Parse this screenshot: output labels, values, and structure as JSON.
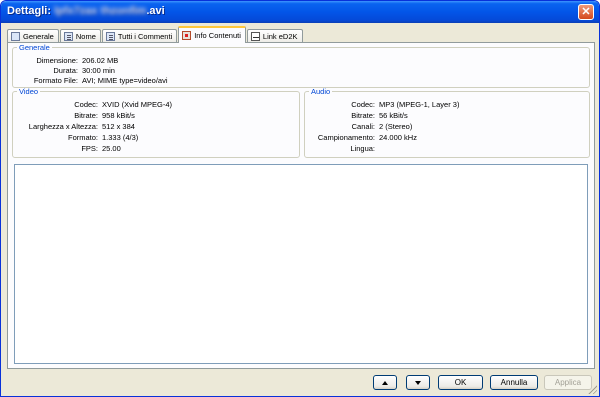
{
  "window": {
    "title_prefix": "Dettagli:",
    "title_obscured": "lpfx7zax  thzonfim",
    "title_suffix": ".avi",
    "close_symbol": "✕"
  },
  "tabs": [
    {
      "label": "Generale",
      "icon": "info-icon"
    },
    {
      "label": "Nome",
      "icon": "name-icon"
    },
    {
      "label": "Tutti i Commenti",
      "icon": "comments-icon"
    },
    {
      "label": "Info Contenuti",
      "icon": "content-info-icon",
      "active": true
    },
    {
      "label": "Link eD2K",
      "icon": "link-icon"
    }
  ],
  "generale": {
    "legend": "Generale",
    "rows": [
      {
        "key": "Dimensione:",
        "value": "206.02 MB"
      },
      {
        "key": "Durata:",
        "value": "30:00 min"
      },
      {
        "key": "Formato File:",
        "value": "AVI; MIME type=video/avi"
      }
    ]
  },
  "video": {
    "legend": "Video",
    "rows": [
      {
        "key": "Codec:",
        "value": "XVID (Xvid MPEG-4)"
      },
      {
        "key": "Bitrate:",
        "value": "958 kBit/s"
      },
      {
        "key": "Larghezza x Altezza:",
        "value": "512 x 384"
      },
      {
        "key": "Formato:",
        "value": "1.333  (4/3)"
      },
      {
        "key": "FPS:",
        "value": "25.00"
      }
    ]
  },
  "audio": {
    "legend": "Audio",
    "rows": [
      {
        "key": "Codec:",
        "value": "MP3 (MPEG-1, Layer 3)"
      },
      {
        "key": "Bitrate:",
        "value": "56 kBit/s"
      },
      {
        "key": "Canali:",
        "value": "2 (Stereo)"
      },
      {
        "key": "Campionamento:",
        "value": "24.000 kHz"
      },
      {
        "key": "Lingua:",
        "value": ""
      }
    ]
  },
  "buttons": {
    "ok": "OK",
    "cancel": "Annulla",
    "apply": "Applica"
  }
}
